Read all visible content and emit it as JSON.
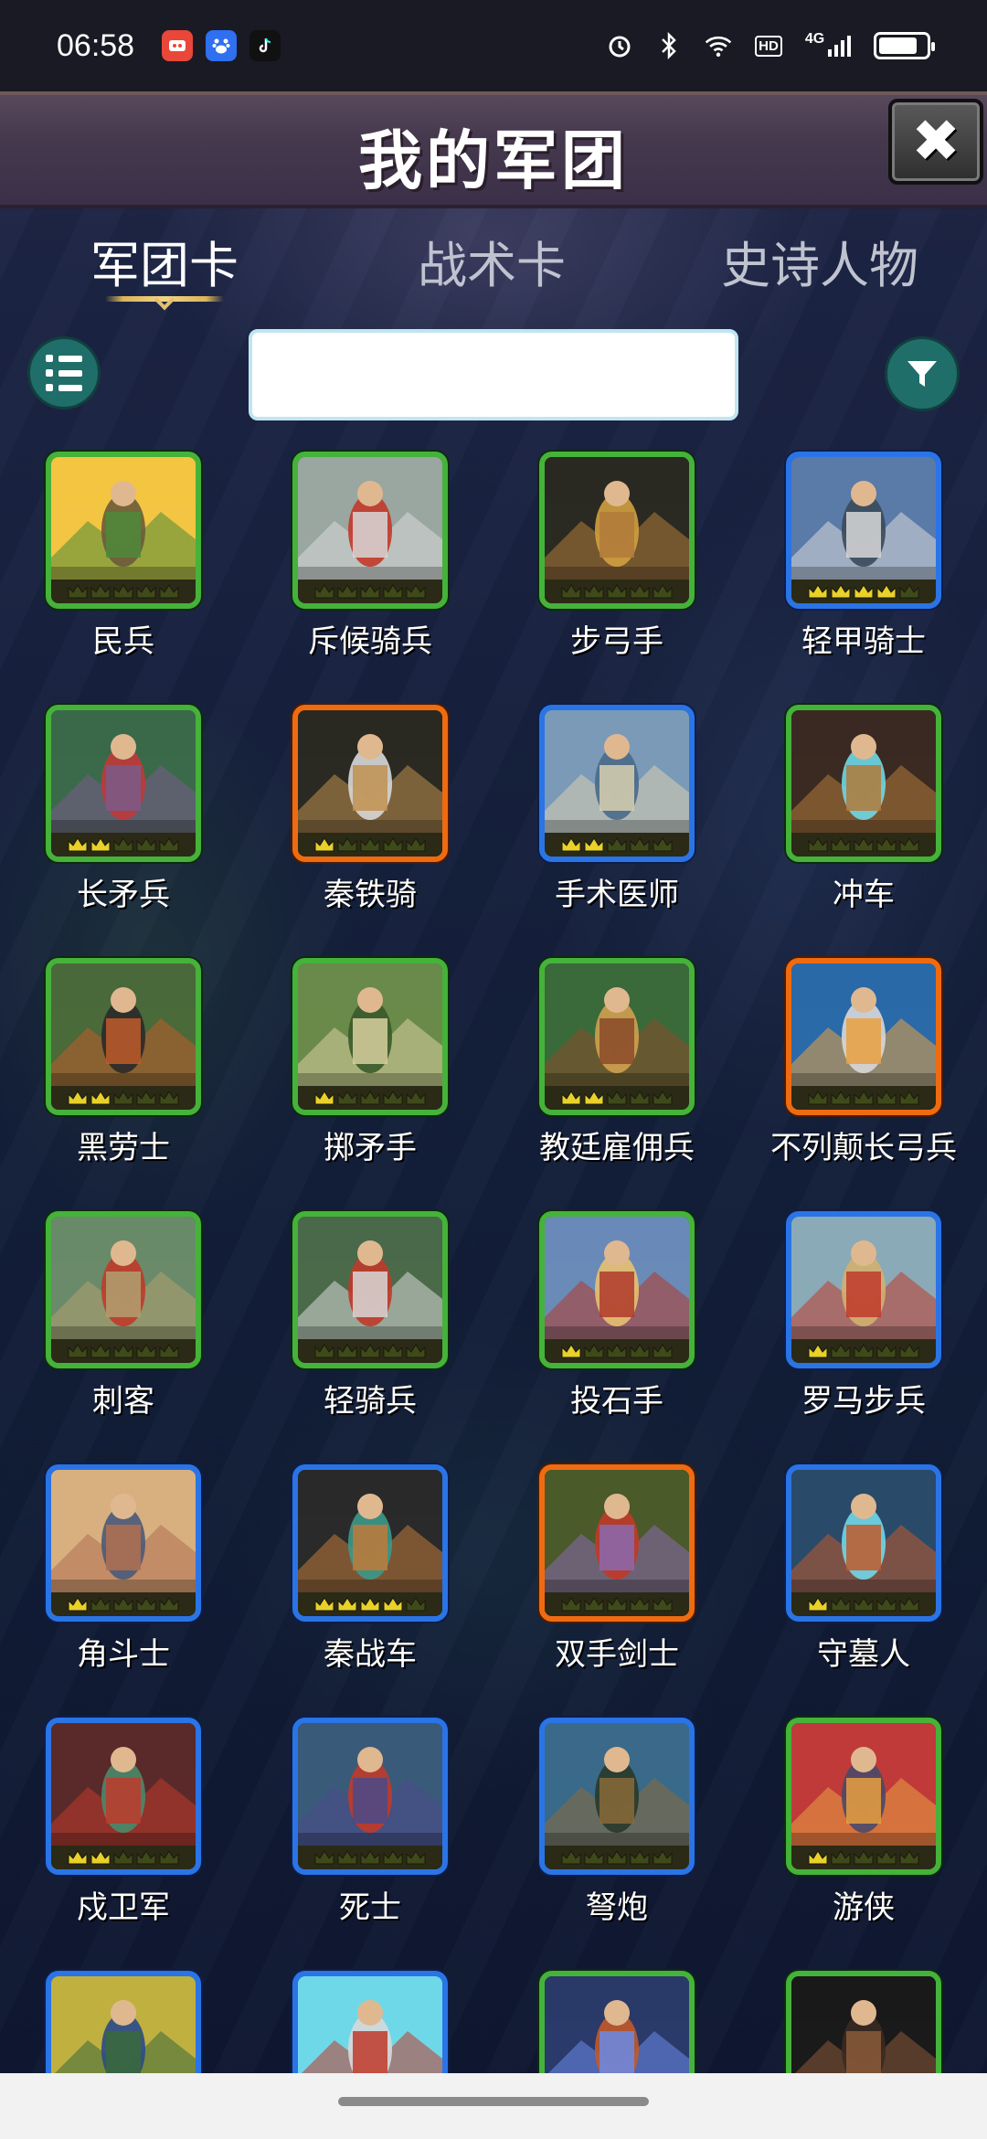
{
  "status_bar": {
    "time": "06:58",
    "apps": [
      {
        "icon": "taobao-app-icon",
        "color": "#e8473a"
      },
      {
        "icon": "baidu-app-icon",
        "color": "#2f6ff0"
      },
      {
        "icon": "tiktok-app-icon",
        "color": "#111111"
      }
    ],
    "icons": [
      "alarm-icon",
      "bluetooth-icon",
      "wifi-icon",
      "hd-icon",
      "signal-4g-icon",
      "battery-icon"
    ],
    "hd_label": "HD",
    "network_label": "4G"
  },
  "header": {
    "title": "我的军团",
    "close_label": "✖"
  },
  "tabs": [
    {
      "label": "军团卡",
      "active": true
    },
    {
      "label": "战术卡",
      "active": false
    },
    {
      "label": "史诗人物",
      "active": false
    }
  ],
  "search": {
    "value": "",
    "placeholder": ""
  },
  "colors": {
    "green": "#45b23a",
    "blue": "#2a74e6",
    "orange": "#ef6b12",
    "teal_button": "#1f6e6a",
    "crown_gold": "#e9d12a",
    "crown_dim": "#3f4a1a"
  },
  "cards": [
    {
      "name": "民兵",
      "rarity": "green",
      "stars": 0,
      "art": [
        "#f4c542",
        "#4d8a3a",
        "#6b5a3a"
      ]
    },
    {
      "name": "斥候骑兵",
      "rarity": "green",
      "stars": 0,
      "art": [
        "#9aa7a0",
        "#d8d8d8",
        "#c23a2a"
      ]
    },
    {
      "name": "步弓手",
      "rarity": "green",
      "stars": 0,
      "art": [
        "#2a2a22",
        "#b07a3a",
        "#d0a040"
      ]
    },
    {
      "name": "轻甲骑士",
      "rarity": "blue",
      "stars": 4,
      "art": [
        "#5a7aa8",
        "#d8d8d8",
        "#3a4a5a"
      ]
    },
    {
      "name": "长矛兵",
      "rarity": "green",
      "stars": 2,
      "art": [
        "#3a6a4a",
        "#7a5a8a",
        "#c03a3a"
      ]
    },
    {
      "name": "秦铁骑",
      "rarity": "orange",
      "stars": 1,
      "art": [
        "#2a2a22",
        "#c09050",
        "#d8d8d8"
      ]
    },
    {
      "name": "手术医师",
      "rarity": "blue",
      "stars": 2,
      "art": [
        "#7a9ab8",
        "#d8d0b0",
        "#4a6a8a"
      ]
    },
    {
      "name": "冲车",
      "rarity": "green",
      "stars": 0,
      "art": [
        "#3a2a22",
        "#b07a3a",
        "#6fd8e8"
      ]
    },
    {
      "name": "黑劳士",
      "rarity": "green",
      "stars": 2,
      "art": [
        "#4a6a3a",
        "#c05a2a",
        "#2a2a2a"
      ]
    },
    {
      "name": "掷矛手",
      "rarity": "green",
      "stars": 1,
      "art": [
        "#6a8a4a",
        "#d8d0a0",
        "#3a5a2a"
      ]
    },
    {
      "name": "教廷雇佣兵",
      "rarity": "green",
      "stars": 2,
      "art": [
        "#3a6a3a",
        "#8a4a2a",
        "#d0a050"
      ]
    },
    {
      "name": "不列颠长弓兵",
      "rarity": "orange",
      "stars": 0,
      "art": [
        "#2a6aa8",
        "#e8a040",
        "#d8d8d8"
      ]
    },
    {
      "name": "刺客",
      "rarity": "green",
      "stars": 0,
      "art": [
        "#6a8a6a",
        "#b0a070",
        "#c03a2a"
      ]
    },
    {
      "name": "轻骑兵",
      "rarity": "green",
      "stars": 0,
      "art": [
        "#4a6a4a",
        "#d8d8d8",
        "#c03a2a"
      ]
    },
    {
      "name": "投石手",
      "rarity": "green",
      "stars": 1,
      "art": [
        "#6a8ab8",
        "#b03a2a",
        "#e8c070"
      ]
    },
    {
      "name": "罗马步兵",
      "rarity": "blue",
      "stars": 1,
      "art": [
        "#8aaab8",
        "#c03a2a",
        "#d0b070"
      ]
    },
    {
      "name": "角斗士",
      "rarity": "blue",
      "stars": 1,
      "art": [
        "#d8b080",
        "#b07050",
        "#4a5a7a"
      ]
    },
    {
      "name": "秦战车",
      "rarity": "blue",
      "stars": 4,
      "art": [
        "#2a2a2a",
        "#c07a3a",
        "#3a9a8a"
      ]
    },
    {
      "name": "双手剑士",
      "rarity": "orange",
      "stars": 0,
      "art": [
        "#4a5a2a",
        "#8a6ab0",
        "#c03a2a"
      ]
    },
    {
      "name": "守墓人",
      "rarity": "blue",
      "stars": 1,
      "art": [
        "#2a4a6a",
        "#c05a2a",
        "#6fd8e8"
      ]
    },
    {
      "name": "戍卫军",
      "rarity": "blue",
      "stars": 2,
      "art": [
        "#5a2a2a",
        "#c03a2a",
        "#4a8a6a"
      ]
    },
    {
      "name": "死士",
      "rarity": "blue",
      "stars": 0,
      "art": [
        "#3a5a7a",
        "#4a4a8a",
        "#c03a2a"
      ]
    },
    {
      "name": "弩炮",
      "rarity": "blue",
      "stars": 0,
      "art": [
        "#3a6a8a",
        "#8a6a3a",
        "#2a3a2a"
      ]
    },
    {
      "name": "游侠",
      "rarity": "green",
      "stars": 1,
      "art": [
        "#c03a3a",
        "#e8a040",
        "#4a4a6a"
      ]
    },
    {
      "name": "",
      "rarity": "blue",
      "stars": 0,
      "art": [
        "#c0b040",
        "#3a6a3a",
        "#2a4a8a"
      ]
    },
    {
      "name": "",
      "rarity": "blue",
      "stars": 0,
      "art": [
        "#6fd8e8",
        "#c03a2a",
        "#d8d8d8"
      ]
    },
    {
      "name": "",
      "rarity": "green",
      "stars": 0,
      "art": [
        "#2a3a6a",
        "#6a8ae8",
        "#c05a2a"
      ]
    },
    {
      "name": "",
      "rarity": "green",
      "stars": 0,
      "art": [
        "#1a1a1a",
        "#8a5a3a",
        "#3a2a22"
      ]
    }
  ]
}
